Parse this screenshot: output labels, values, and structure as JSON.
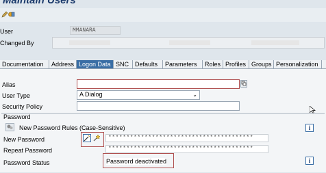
{
  "window": {
    "title": "Maintain Users"
  },
  "toolbar": {
    "icons": [
      "pencil-icon",
      "toggle-icon"
    ]
  },
  "header": {
    "user_label": "User",
    "user_value": "MMANARA",
    "changed_by_label": "Changed By"
  },
  "tabs": [
    {
      "label": "Documentation"
    },
    {
      "label": "Address"
    },
    {
      "label": "Logon Data"
    },
    {
      "label": "SNC"
    },
    {
      "label": "Defaults"
    },
    {
      "label": "Parameters"
    },
    {
      "label": "Roles"
    },
    {
      "label": "Profiles"
    },
    {
      "label": "Groups"
    },
    {
      "label": "Personalization"
    }
  ],
  "logon": {
    "alias_label": "Alias",
    "alias_value": "",
    "user_type_label": "User Type",
    "user_type_value": "A Dialog",
    "security_policy_label": "Security Policy",
    "security_policy_value": ""
  },
  "password": {
    "section_title": "Password",
    "rules_label": "New Password Rules (Case-Sensitive)",
    "new_label": "New Password",
    "new_value": "****************************************",
    "repeat_label": "Repeat Password",
    "repeat_value": "****************************************",
    "status_label": "Password Status",
    "status_value": "Password deactivated",
    "info_symbol": "i"
  },
  "colors": {
    "accent": "#3a6ea5",
    "highlight": "#b05050"
  }
}
